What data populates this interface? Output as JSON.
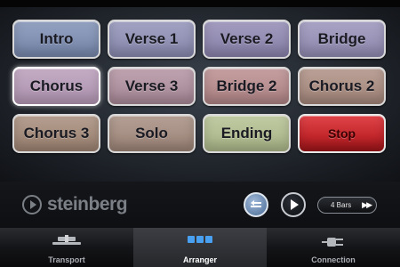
{
  "pads": [
    {
      "label": "Intro",
      "bg": "#7c8db3",
      "selected": false
    },
    {
      "label": "Verse 1",
      "bg": "#8e8fb6",
      "selected": false
    },
    {
      "label": "Verse 2",
      "bg": "#8f87b2",
      "selected": false
    },
    {
      "label": "Bridge",
      "bg": "#9690b8",
      "selected": false
    },
    {
      "label": "Chorus",
      "bg": "#b79ab8",
      "selected": true
    },
    {
      "label": "Verse 3",
      "bg": "#b08f9e",
      "selected": false
    },
    {
      "label": "Bridge 2",
      "bg": "#b88a8c",
      "selected": false
    },
    {
      "label": "Chorus 2",
      "bg": "#ab8c80",
      "selected": false
    },
    {
      "label": "Chorus 3",
      "bg": "#a48977",
      "selected": false
    },
    {
      "label": "Solo",
      "bg": "#a48a7d",
      "selected": false
    },
    {
      "label": "Ending",
      "bg": "#b3bf8f",
      "selected": false
    },
    {
      "label": "Stop",
      "bg": "#c2262b",
      "selected": false
    }
  ],
  "toolbar": {
    "logo_text": "steinberg",
    "bars_label": "4 Bars",
    "fast_forward_glyph": "▶▶"
  },
  "tabs": [
    {
      "label": "Transport",
      "icon": "transport-icon",
      "selected": false
    },
    {
      "label": "Arranger",
      "icon": "arranger-icon",
      "selected": true
    },
    {
      "label": "Connection",
      "icon": "plug-icon",
      "selected": false
    }
  ],
  "colors": {
    "tab_selected_text": "#ffffff",
    "tab_text": "#a9acb2",
    "accent_blue": "#4a6c96"
  }
}
